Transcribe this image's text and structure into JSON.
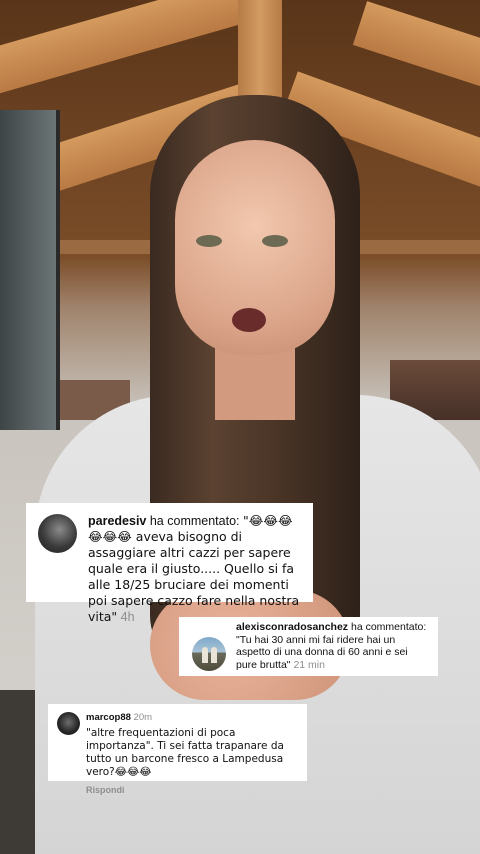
{
  "comments": [
    {
      "username": "paredesiv",
      "action": "ha commentato:",
      "text": "\"😂😂😂 😂😂😂 aveva bisogno di assaggiare altri cazzi per sapere quale era il giusto..... Quello si fa alle 18/25 bruciare dei momenti poi sapere cazzo fare nella nostra vita\"",
      "time": "4h"
    },
    {
      "username": "alexisconradosanchez",
      "action": "ha commentato:",
      "text": "\"Tu hai 30 anni mi fai ridere hai un aspetto di una donna di 60 anni e sei pure brutta\"",
      "time": "21 min"
    },
    {
      "username": "marcop88",
      "time": "20m",
      "text": "\"altre frequentazioni di poca importanza\". Ti sei fatta trapanare da tutto un barcone fresco a Lampedusa vero?😂😂😂",
      "reply_label": "Rispondi"
    }
  ]
}
